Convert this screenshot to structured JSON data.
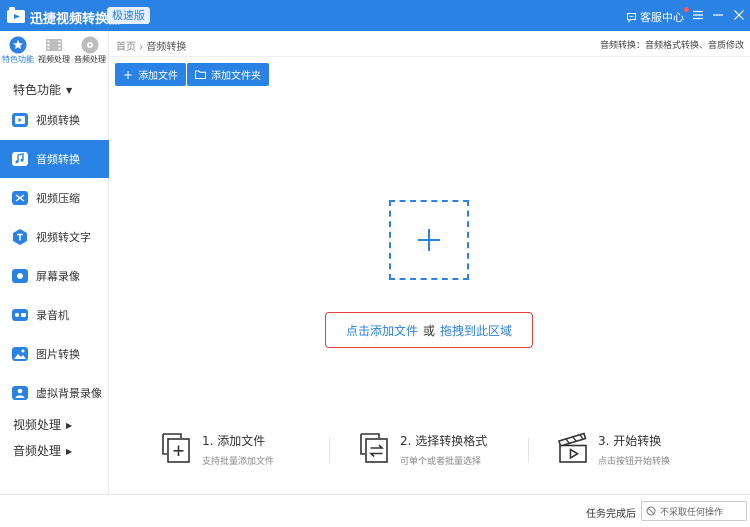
{
  "app": {
    "title": "迅捷视频转换器",
    "edition": "极速版",
    "service_label": "客服中心",
    "accent_color": "#2a82e4"
  },
  "sidebar": {
    "tabs": [
      {
        "label": "特色功能",
        "icon": "star-icon",
        "active": true
      },
      {
        "label": "视频处理",
        "icon": "film-icon",
        "active": false
      },
      {
        "label": "音频处理",
        "icon": "disc-icon",
        "active": false
      }
    ],
    "featured_group": "特色功能",
    "items": [
      {
        "label": "视频转换",
        "icon": "video-convert-icon",
        "active": false
      },
      {
        "label": "音频转换",
        "icon": "audio-convert-icon",
        "active": true
      },
      {
        "label": "视频压缩",
        "icon": "video-compress-icon",
        "active": false
      },
      {
        "label": "视频转文字",
        "icon": "video-to-text-icon",
        "active": false
      },
      {
        "label": "屏幕录像",
        "icon": "screen-record-icon",
        "active": false
      },
      {
        "label": "录音机",
        "icon": "recorder-icon",
        "active": false
      },
      {
        "label": "图片转换",
        "icon": "image-convert-icon",
        "active": false
      },
      {
        "label": "虚拟背景录像",
        "icon": "virtual-background-icon",
        "active": false
      }
    ],
    "video_group": "视频处理",
    "audio_group": "音频处理"
  },
  "main": {
    "breadcrumb": {
      "home": "首页",
      "current": "音频转换"
    },
    "hint": "音频转换：音频格式转换、音质修改",
    "toolbar": {
      "add_file": "添加文件",
      "add_folder": "添加文件夹"
    },
    "drop": {
      "click_text": "点击添加文件",
      "or_text": "或",
      "drag_text": "拖拽到此区域"
    },
    "steps": [
      {
        "title": "1. 添加文件",
        "desc": "支持批量添加文件",
        "icon": "add-file-icon"
      },
      {
        "title": "2. 选择转换格式",
        "desc": "可单个或者批量选择",
        "icon": "select-format-icon"
      },
      {
        "title": "3. 开始转换",
        "desc": "点击按钮开始转换",
        "icon": "start-convert-icon"
      }
    ]
  },
  "footer": {
    "after_label": "任务完成后",
    "after_value": "不采取任何操作"
  }
}
